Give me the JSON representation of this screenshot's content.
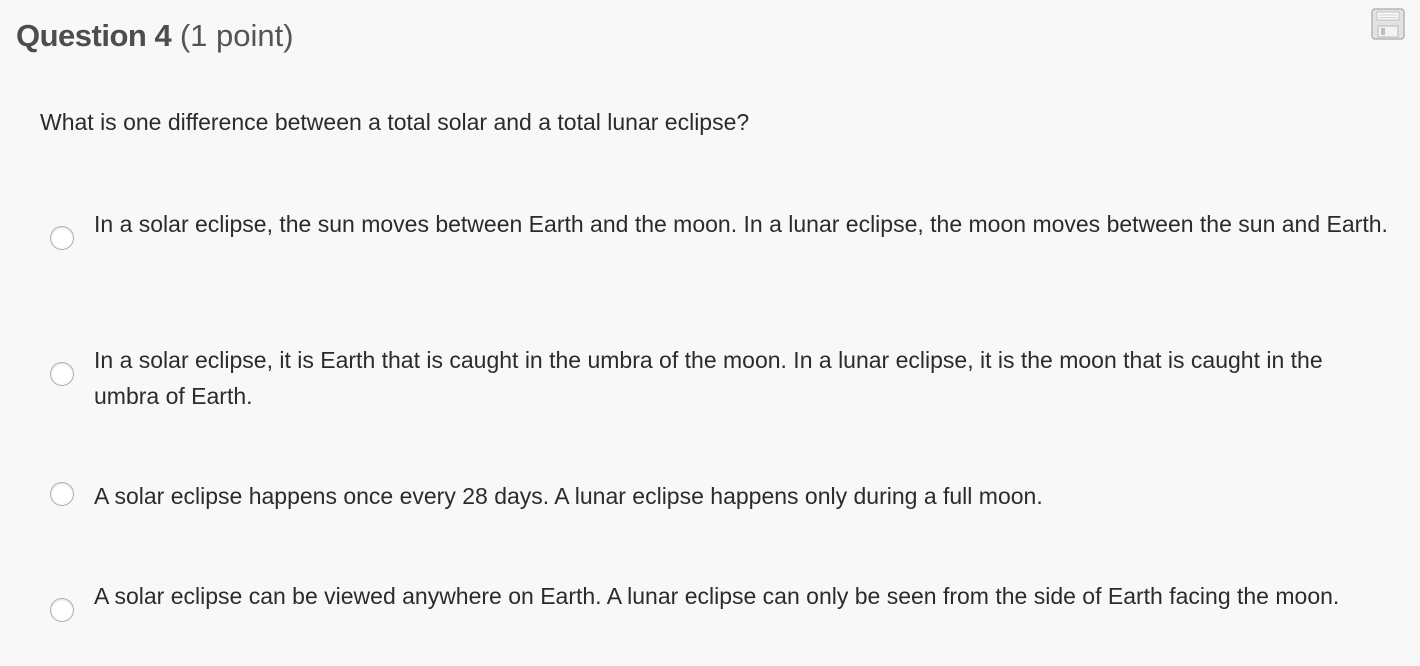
{
  "question": {
    "title": "Question 4",
    "points": "(1 point)",
    "prompt": "What is one difference between a total solar and a total lunar eclipse?"
  },
  "toolbar": {
    "save_icon": "save-icon"
  },
  "choices": [
    {
      "text": "In a solar eclipse, the sun moves between Earth and the moon. In a lunar eclipse, the moon moves between the sun and Earth.",
      "selected": false
    },
    {
      "text": "In a solar eclipse, it is Earth that is caught in the umbra of the moon. In a lunar eclipse, it is the moon that is caught in the umbra of Earth.",
      "selected": false
    },
    {
      "text": "A solar eclipse happens once every 28 days. A lunar eclipse happens only during a full moon.",
      "selected": false
    },
    {
      "text": "A solar eclipse can be viewed anywhere on Earth. A lunar eclipse can only be seen from the side of Earth facing the moon.",
      "selected": false
    }
  ]
}
